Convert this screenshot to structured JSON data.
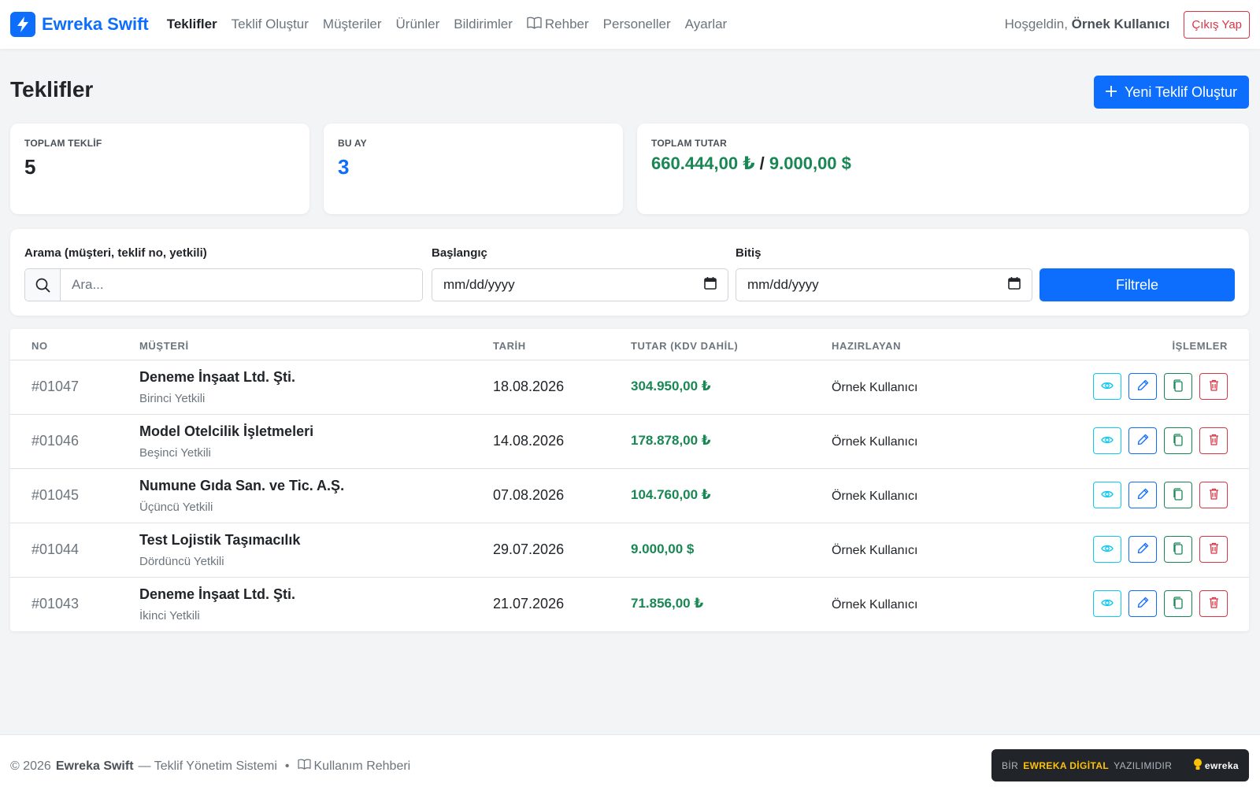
{
  "nav": {
    "brand": "Ewreka Swift",
    "links": [
      {
        "label": "Teklifler",
        "active": true
      },
      {
        "label": "Teklif Oluştur"
      },
      {
        "label": "Müşteriler"
      },
      {
        "label": "Ürünler"
      },
      {
        "label": "Bildirimler"
      },
      {
        "label": "Rehber",
        "icon": "book-icon"
      },
      {
        "label": "Personeller"
      },
      {
        "label": "Ayarlar"
      }
    ],
    "welcome_prefix": "Hoşgeldin,",
    "welcome_user": "Örnek Kullanıcı",
    "logout_label": "Çıkış Yap"
  },
  "page": {
    "title": "Teklifler",
    "new_button": "Yeni Teklif Oluştur"
  },
  "stats": {
    "total_label": "TOPLAM TEKLİF",
    "total_value": "5",
    "month_label": "BU AY",
    "month_value": "3",
    "amount_label": "TOPLAM TUTAR",
    "amount_try": "660.444,00 ₺",
    "amount_sep": "/",
    "amount_usd": "9.000,00 $"
  },
  "filter": {
    "search_label": "Arama (müşteri, teklif no, yetkili)",
    "search_placeholder": "Ara...",
    "start_label": "Başlangıç",
    "start_value": "mm/dd/yyyy",
    "end_label": "Bitiş",
    "end_value": "mm/dd/yyyy",
    "button": "Filtrele"
  },
  "table": {
    "headers": {
      "no": "NO",
      "customer": "MÜŞTERİ",
      "date": "TARİH",
      "amount": "TUTAR (KDV DAHİL)",
      "prepared_by": "HAZIRLAYAN",
      "actions": "İŞLEMLER"
    },
    "rows": [
      {
        "no": "#01047",
        "customer": "Deneme İnşaat Ltd. Şti.",
        "contact": "Birinci Yetkili",
        "date": "18.08.2026",
        "amount": "304.950,00 ₺",
        "prepared_by": "Örnek Kullanıcı"
      },
      {
        "no": "#01046",
        "customer": "Model Otelcilik İşletmeleri",
        "contact": "Beşinci Yetkili",
        "date": "14.08.2026",
        "amount": "178.878,00 ₺",
        "prepared_by": "Örnek Kullanıcı"
      },
      {
        "no": "#01045",
        "customer": "Numune Gıda San. ve Tic. A.Ş.",
        "contact": "Üçüncü Yetkili",
        "date": "07.08.2026",
        "amount": "104.760,00 ₺",
        "prepared_by": "Örnek Kullanıcı"
      },
      {
        "no": "#01044",
        "customer": "Test Lojistik Taşımacılık",
        "contact": "Dördüncü Yetkili",
        "date": "29.07.2026",
        "amount": "9.000,00 $",
        "prepared_by": "Örnek Kullanıcı"
      },
      {
        "no": "#01043",
        "customer": "Deneme İnşaat Ltd. Şti.",
        "contact": "İkinci Yetkili",
        "date": "21.07.2026",
        "amount": "71.856,00 ₺",
        "prepared_by": "Örnek Kullanıcı"
      }
    ]
  },
  "footer": {
    "copyright": "© 2026",
    "brand": "Ewreka Swift",
    "tagline": "— Teklif Yönetim Sistemi",
    "separator": "•",
    "guide_label": "Kullanım Rehberi",
    "badge_prefix": "BİR",
    "badge_highlight": "EWREKA DİGİTAL",
    "badge_suffix": "YAZILIMIDIR",
    "badge_logo": "ewreka"
  },
  "colors": {
    "primary": "#0d6efd",
    "success": "#198754",
    "danger": "#dc3545",
    "info": "#0dcaf0",
    "page_bg": "#f3f4f6"
  }
}
